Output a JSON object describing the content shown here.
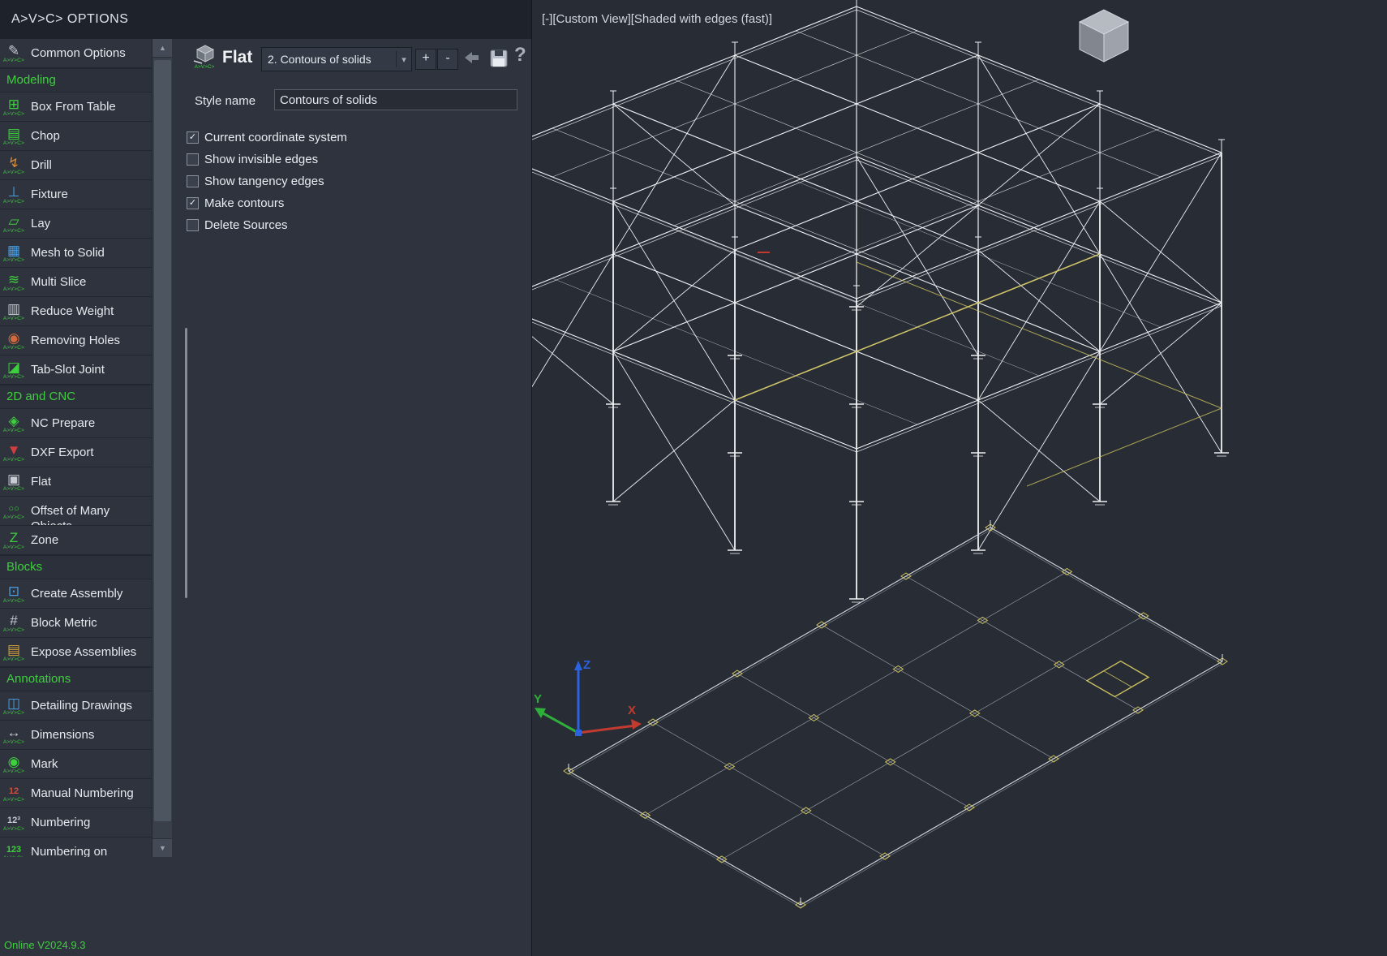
{
  "window": {
    "title": "A>V>C> OPTIONS",
    "status": "Online V2024.9.3"
  },
  "icons": {
    "scroll_up": "▲",
    "scroll_down": "▼",
    "dropdown_arrow": "▾",
    "check_glyph": "✓"
  },
  "sidebar": {
    "icon_caption": "A>V>C>",
    "entries": [
      {
        "type": "item",
        "label": "Common Options",
        "icon": "common-options-icon",
        "glyph": "✎",
        "color": "#c7cbd2"
      },
      {
        "type": "section",
        "label": "Modeling"
      },
      {
        "type": "item",
        "label": "Box From Table",
        "icon": "box-from-table-icon",
        "glyph": "⊞",
        "color": "#3ecf3e"
      },
      {
        "type": "item",
        "label": "Chop",
        "icon": "chop-icon",
        "glyph": "▤",
        "color": "#3ecf3e"
      },
      {
        "type": "item",
        "label": "Drill",
        "icon": "drill-icon",
        "glyph": "↯",
        "color": "#d28b3c"
      },
      {
        "type": "item",
        "label": "Fixture",
        "icon": "fixture-icon",
        "glyph": "⊥",
        "color": "#4a9fe3"
      },
      {
        "type": "item",
        "label": "Lay",
        "icon": "lay-icon",
        "glyph": "▱",
        "color": "#3ecf3e"
      },
      {
        "type": "item",
        "label": "Mesh to Solid",
        "icon": "mesh-to-solid-icon",
        "glyph": "▦",
        "color": "#4a9fe3"
      },
      {
        "type": "item",
        "label": "Multi Slice",
        "icon": "multi-slice-icon",
        "glyph": "≋",
        "color": "#3ecf3e"
      },
      {
        "type": "item",
        "label": "Reduce Weight",
        "icon": "reduce-weight-icon",
        "glyph": "▥",
        "color": "#c7cbd2"
      },
      {
        "type": "item",
        "label": "Removing Holes",
        "icon": "removing-holes-icon",
        "glyph": "◉",
        "color": "#cf6a3e"
      },
      {
        "type": "item",
        "label": "Tab-Slot Joint",
        "icon": "tab-slot-joint-icon",
        "glyph": "◪",
        "color": "#3ecf3e"
      },
      {
        "type": "section",
        "label": "2D and CNC"
      },
      {
        "type": "item",
        "label": "NC Prepare",
        "icon": "nc-prepare-icon",
        "glyph": "◈",
        "color": "#3ecf3e"
      },
      {
        "type": "item",
        "label": "DXF Export",
        "icon": "dxf-export-icon",
        "glyph": "▼",
        "color": "#cf3e3e"
      },
      {
        "type": "item",
        "label": "Flat",
        "icon": "flat-icon",
        "glyph": "▣",
        "color": "#c7cbd2"
      },
      {
        "type": "item",
        "label": "Offset of Many Objects",
        "icon": "offset-of-many-objects-icon",
        "glyph": "○○",
        "color": "#3ecf3e"
      },
      {
        "type": "item",
        "label": "Zone",
        "icon": "zone-icon",
        "glyph": "Z",
        "color": "#3ecf3e"
      },
      {
        "type": "section",
        "label": "Blocks"
      },
      {
        "type": "item",
        "label": "Create Assembly",
        "icon": "create-assembly-icon",
        "glyph": "⊡",
        "color": "#4a9fe3"
      },
      {
        "type": "item",
        "label": "Block Metric",
        "icon": "block-metric-icon",
        "glyph": "#",
        "color": "#c7cbd2"
      },
      {
        "type": "item",
        "label": "Expose Assemblies",
        "icon": "expose-assemblies-icon",
        "glyph": "▤",
        "color": "#d2a23c"
      },
      {
        "type": "section",
        "label": "Annotations"
      },
      {
        "type": "item",
        "label": "Detailing Drawings",
        "icon": "detailing-icon",
        "glyph": "◫",
        "color": "#4a9fe3"
      },
      {
        "type": "item",
        "label": "Dimensions",
        "icon": "dimensions-icon",
        "glyph": "↔",
        "color": "#c7cbd2"
      },
      {
        "type": "item",
        "label": "Mark",
        "icon": "mark-icon",
        "glyph": "◉",
        "color": "#3ecf3e"
      },
      {
        "type": "item",
        "label": "Manual Numbering",
        "icon": "manual-numbering-icon",
        "glyph": "12",
        "color": "#cf4f3e"
      },
      {
        "type": "item",
        "label": "Numbering",
        "icon": "numbering-icon",
        "glyph": "12³",
        "color": "#c7cbd2"
      },
      {
        "type": "item",
        "label": "Numbering on",
        "icon": "numbering-on-icon",
        "glyph": "123",
        "color": "#3ecf3e"
      }
    ]
  },
  "panel": {
    "command_title": "Flat",
    "style_dropdown_value": "2. Contours of solids",
    "buttons": {
      "add": "+",
      "remove": "-",
      "help": "?"
    },
    "style_name_label": "Style name",
    "style_name_value": "Contours of solids",
    "checkboxes": [
      {
        "label": "Current coordinate system",
        "checked": true
      },
      {
        "label": "Show invisible edges",
        "checked": false
      },
      {
        "label": "Show tangency edges",
        "checked": false
      },
      {
        "label": "Make contours",
        "checked": true
      },
      {
        "label": "Delete Sources",
        "checked": false
      }
    ]
  },
  "viewport": {
    "view_label": "[-][Custom View][Shaded with edges (fast)]",
    "axis_labels": {
      "x": "X",
      "y": "Y",
      "z": "Z"
    },
    "colors": {
      "x": "#c23b2e",
      "y": "#2fae3a",
      "z": "#2b62e0",
      "wire": "#eef0f2",
      "accent": "#cdc15e",
      "label": "#d4d7dc"
    }
  }
}
